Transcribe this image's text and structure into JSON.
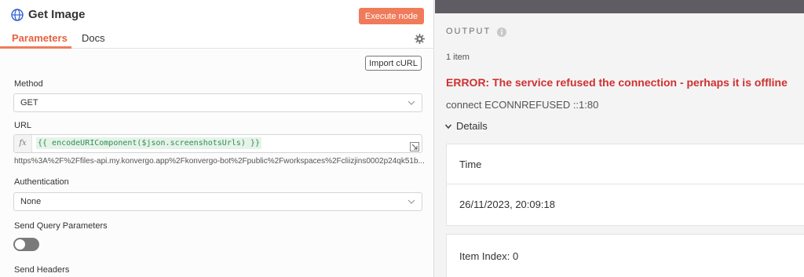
{
  "node": {
    "title": "Get Image",
    "execute_label": "Execute node",
    "tabs": [
      "Parameters",
      "Docs"
    ]
  },
  "params": {
    "import_label": "Import cURL",
    "method_label": "Method",
    "method_value": "GET",
    "url_label": "URL",
    "fx": "fx",
    "url_expression": "{{ encodeURIComponent($json.screenshotsUrls) }}",
    "url_preview": "https%3A%2F%2Ffiles-api.my.konvergo.app%2Fkonvergo-bot%2Fpublic%2Fworkspaces%2Fcliizjins0002p24qk51b...",
    "auth_label": "Authentication",
    "auth_value": "None",
    "query_label": "Send Query Parameters",
    "query_enabled": false,
    "headers_label": "Send Headers"
  },
  "output": {
    "title": "OUTPUT",
    "items": "1 item",
    "error_title": "ERROR: The service refused the connection - perhaps it is offline",
    "error_message": "connect ECONNREFUSED ::1:80",
    "details_label": "Details",
    "time_label": "Time",
    "time_value": "26/11/2023, 20:09:18",
    "item_index_label": "Item Index:",
    "item_index_value": "0"
  },
  "colors": {
    "accent": "#ef7b5a",
    "error": "#d0302f",
    "expression_bg": "#e6f3ea",
    "expression_text": "#2f8f4f"
  },
  "icons": [
    "globe-icon",
    "gear-icon",
    "chevron-down-icon",
    "expand-icon",
    "info-icon"
  ]
}
